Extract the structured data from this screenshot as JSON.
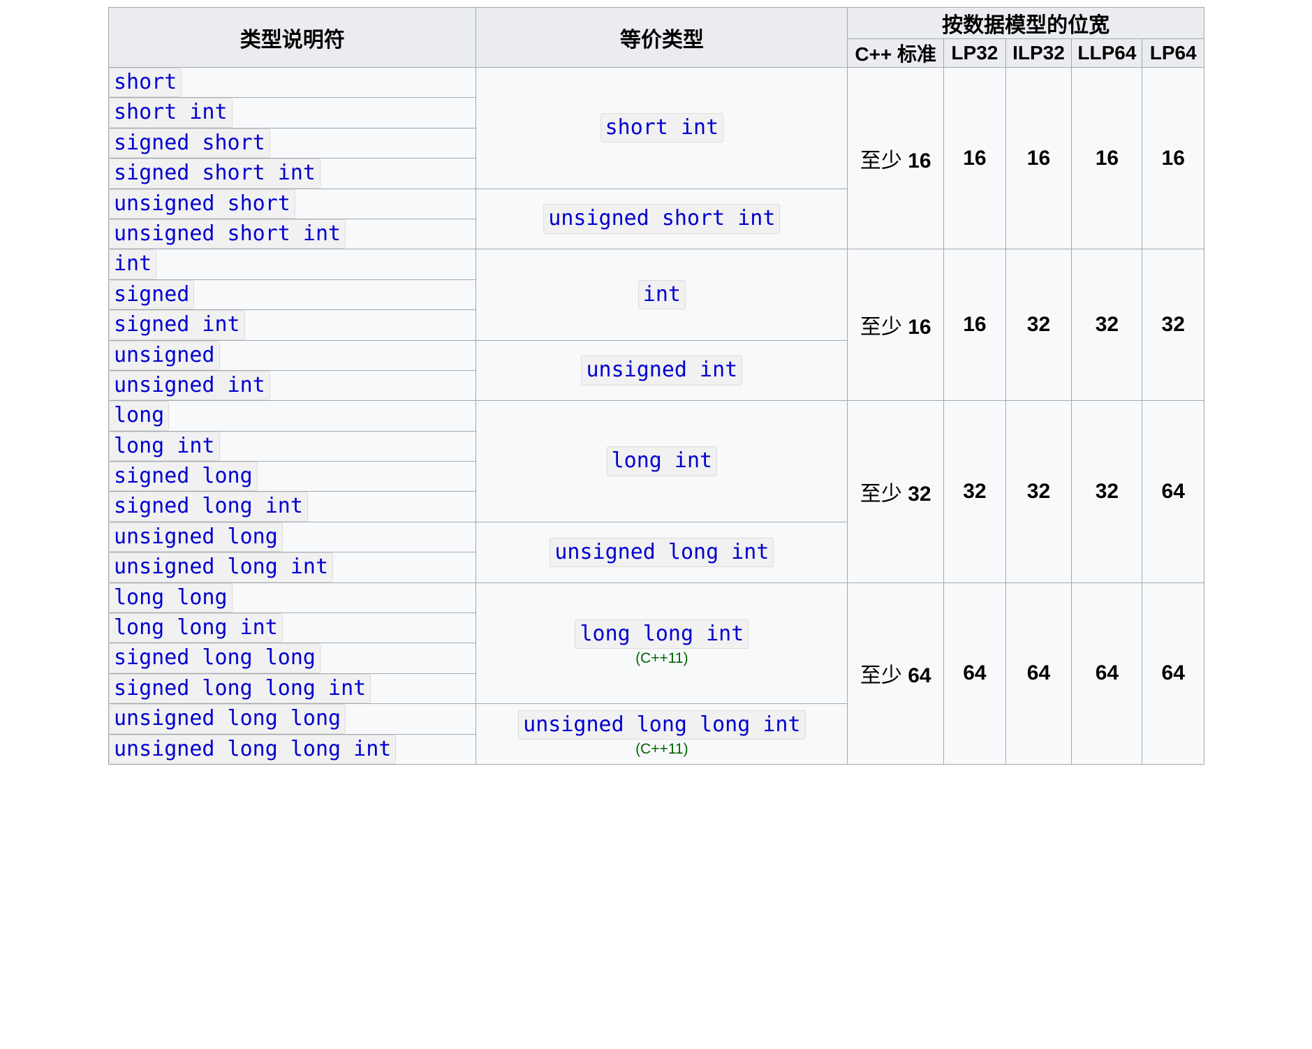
{
  "table": {
    "headers": {
      "type_specifier": "类型说明符",
      "equivalent_type": "等价类型",
      "width_group": "按数据模型的位宽",
      "models": [
        "C++ 标准",
        "LP32",
        "ILP32",
        "LLP64",
        "LP64"
      ]
    },
    "groups": [
      {
        "id": "short",
        "specifiers": [
          "short",
          "short int",
          "signed short",
          "signed short int",
          "unsigned short",
          "unsigned short int"
        ],
        "equivalents": [
          {
            "code": "short int",
            "note": "",
            "rows": 4
          },
          {
            "code": "unsigned short int",
            "note": "",
            "rows": 2
          }
        ],
        "widths": {
          "std_prefix": "至少",
          "std": "16",
          "lp32": "16",
          "ilp32": "16",
          "llp64": "16",
          "lp64": "16"
        }
      },
      {
        "id": "int",
        "specifiers": [
          "int",
          "signed",
          "signed int",
          "unsigned",
          "unsigned int"
        ],
        "equivalents": [
          {
            "code": "int",
            "note": "",
            "rows": 3
          },
          {
            "code": "unsigned int",
            "note": "",
            "rows": 2
          }
        ],
        "widths": {
          "std_prefix": "至少",
          "std": "16",
          "lp32": "16",
          "ilp32": "32",
          "llp64": "32",
          "lp64": "32"
        }
      },
      {
        "id": "long",
        "specifiers": [
          "long",
          "long int",
          "signed long",
          "signed long int",
          "unsigned long",
          "unsigned long int"
        ],
        "equivalents": [
          {
            "code": "long int",
            "note": "",
            "rows": 4
          },
          {
            "code": "unsigned long int",
            "note": "",
            "rows": 2
          }
        ],
        "widths": {
          "std_prefix": "至少",
          "std": "32",
          "lp32": "32",
          "ilp32": "32",
          "llp64": "32",
          "lp64": "64"
        }
      },
      {
        "id": "long-long",
        "specifiers": [
          "long long",
          "long long int",
          "signed long long",
          "signed long long int",
          "unsigned long long",
          "unsigned long long int"
        ],
        "equivalents": [
          {
            "code": "long long int",
            "note": "(C++11)",
            "rows": 4
          },
          {
            "code": "unsigned long long int",
            "note": "(C++11)",
            "rows": 2
          }
        ],
        "widths": {
          "std_prefix": "至少",
          "std": "64",
          "lp32": "64",
          "ilp32": "64",
          "llp64": "64",
          "lp64": "64"
        }
      }
    ]
  },
  "colors": {
    "code_text": "#0000d0",
    "code_bg": "#f1f1f1",
    "code_border": "#dcdcdc",
    "note_green": "#006400",
    "table_border": "#a2a9b1",
    "header_bg": "#eaecf0",
    "body_bg": "#f8f9fa"
  }
}
